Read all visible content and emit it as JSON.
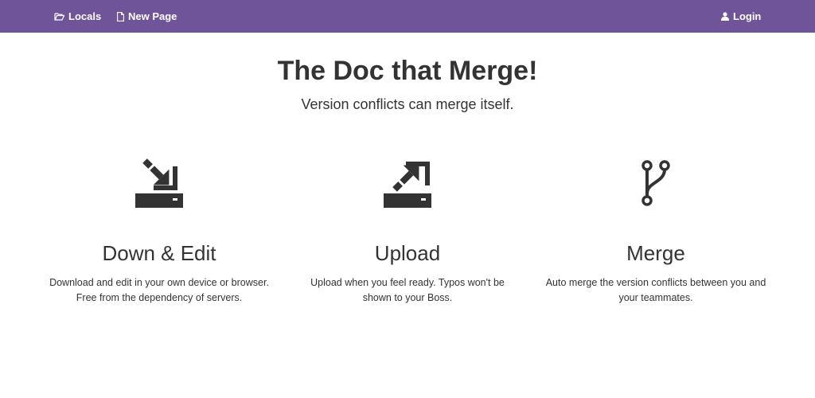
{
  "navbar": {
    "accent_color": "#6f5499",
    "items": [
      {
        "label": "Locals",
        "icon": "folder-open-icon"
      },
      {
        "label": "New Page",
        "icon": "file-icon"
      }
    ],
    "login": {
      "label": "Login",
      "icon": "user-icon"
    }
  },
  "hero": {
    "title": "The Doc that Merge!",
    "subtitle": "Version conflicts can merge itself."
  },
  "features": [
    {
      "icon": "download-icon",
      "title": "Down & Edit",
      "line1": "Download and edit in your own device or browser.",
      "line2": "Free from the dependency of servers."
    },
    {
      "icon": "upload-icon",
      "title": "Upload",
      "line1": "Upload when you feel ready. Typos won't be",
      "line2": "shown to your Boss."
    },
    {
      "icon": "merge-branch-icon",
      "title": "Merge",
      "line1": "Auto merge the version conflicts between you and",
      "line2": "your teammates."
    }
  ]
}
